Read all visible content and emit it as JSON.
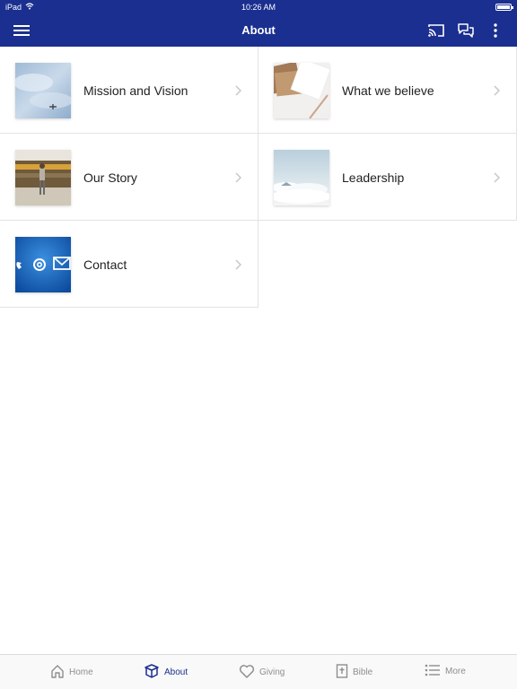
{
  "status_bar": {
    "device": "iPad",
    "time": "10:26 AM"
  },
  "header": {
    "title": "About"
  },
  "items": [
    {
      "label": "Mission and Vision"
    },
    {
      "label": "What we believe"
    },
    {
      "label": "Our Story"
    },
    {
      "label": "Leadership"
    },
    {
      "label": "Contact"
    }
  ],
  "tabs": [
    {
      "label": "Home"
    },
    {
      "label": "About"
    },
    {
      "label": "Giving"
    },
    {
      "label": "Bible"
    },
    {
      "label": "More"
    }
  ],
  "colors": {
    "brand": "#1a2f8f",
    "inactive_tab": "#8e8e8e"
  },
  "icons": {
    "header": [
      "menu-icon",
      "cast-icon",
      "chat-icon",
      "more-vertical-icon"
    ],
    "tabs": [
      "home-icon",
      "about-icon",
      "heart-icon",
      "bible-icon",
      "list-icon"
    ]
  }
}
